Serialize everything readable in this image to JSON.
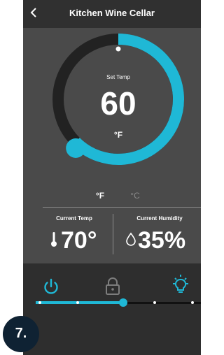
{
  "app": {
    "title": "Kitchen Wine Cellar"
  },
  "icons": {
    "back": "back-chevron-icon"
  },
  "dial": {
    "label": "Set Temp",
    "value": "60",
    "unit": "°F"
  },
  "units": {
    "fahrenheit": "°F",
    "celsius": "°C",
    "selected": "°F"
  },
  "current_temp": {
    "label": "Current Temp",
    "value": "70°"
  },
  "current_humidity": {
    "label": "Current Humidity",
    "value": "35%"
  },
  "controls": [
    "power-icon",
    "lock-icon",
    "light-bulb-icon"
  ],
  "slider": {
    "level": 0.53,
    "stops": 5
  },
  "step": {
    "label": "7."
  },
  "colors": {
    "accent": "#1fb8d6",
    "panel": "#4a4a4a",
    "bar": "#303030",
    "badge": "#0f2233"
  }
}
